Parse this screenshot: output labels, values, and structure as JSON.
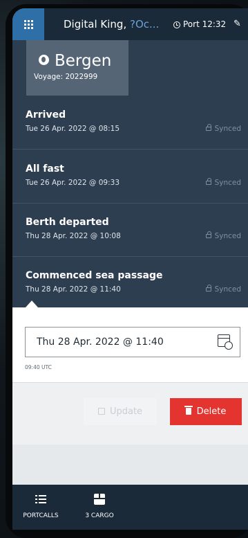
{
  "header": {
    "title": "Digital King, ",
    "title_truncated": "?Oc...",
    "port_time": "Port 12:32"
  },
  "location": {
    "name": "Bergen",
    "voyage": "Voyage: 2022999"
  },
  "events": [
    {
      "title": "Arrived",
      "date": "Tue 26 Apr. 2022 @ 08:15",
      "status": "Synced"
    },
    {
      "title": "All fast",
      "date": "Tue 26 Apr. 2022 @ 09:33",
      "status": "Synced"
    },
    {
      "title": "Berth departed",
      "date": "Thu 28 Apr. 2022 @ 10:08",
      "status": "Synced"
    },
    {
      "title": "Commenced sea passage",
      "date": "Thu 28 Apr. 2022 @ 11:40",
      "status": "Synced"
    }
  ],
  "edit": {
    "date_value": "Thu 28 Apr. 2022 @ 11:40",
    "utc": "09:40 UTC"
  },
  "actions": {
    "update_label": "Update",
    "delete_label": "Delete"
  },
  "nav": {
    "portcalls_label": "PORTCALLS",
    "cargo_label": "3 CARGO"
  },
  "colors": {
    "header_bg": "#1b2a38",
    "accent": "#2f6fa8",
    "list_bg": "#2d3e50",
    "delete": "#e3342f"
  },
  "icons": [
    "grid-icon",
    "clock-icon",
    "pen-icon",
    "globe-icon",
    "lock-icon",
    "calendar-clock-icon",
    "save-icon",
    "trash-icon",
    "list-icon",
    "box-icon"
  ]
}
